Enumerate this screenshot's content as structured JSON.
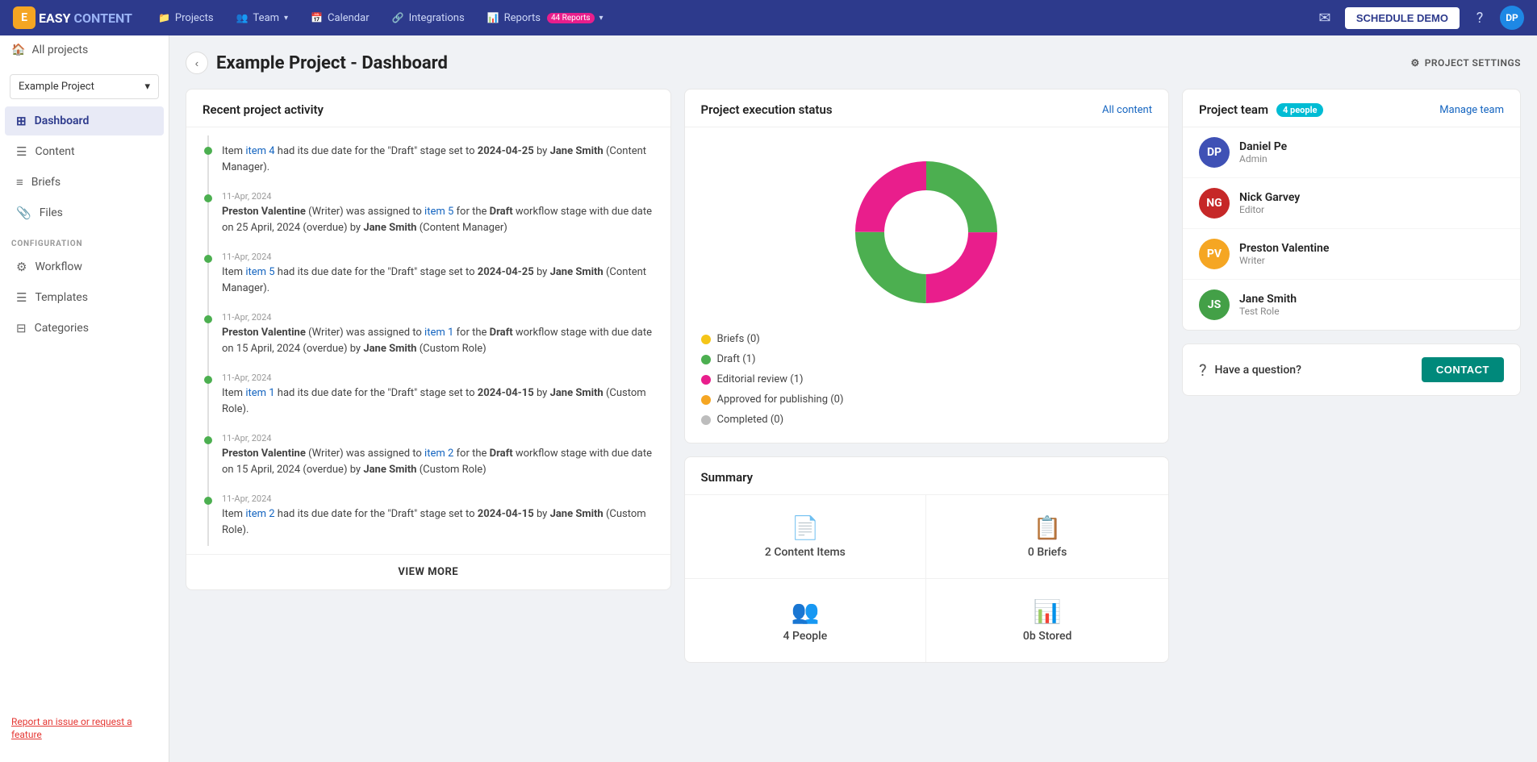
{
  "app": {
    "logo_easy": "EASY",
    "logo_content": "CONTENT",
    "logo_initial": "E"
  },
  "topnav": {
    "projects": "Projects",
    "team": "Team",
    "calendar": "Calendar",
    "integrations": "Integrations",
    "reports": "Reports",
    "reports_badge": "44 Reports",
    "schedule_demo": "SCHEDULE DEMO",
    "user_initials": "DP"
  },
  "sidebar": {
    "all_projects": "All projects",
    "project_name": "Example Project",
    "nav": [
      {
        "id": "dashboard",
        "label": "Dashboard",
        "icon": "⊞",
        "active": true
      },
      {
        "id": "content",
        "label": "Content",
        "icon": "☰",
        "active": false
      },
      {
        "id": "briefs",
        "label": "Briefs",
        "icon": "≡",
        "active": false
      },
      {
        "id": "files",
        "label": "Files",
        "icon": "📎",
        "active": false
      }
    ],
    "config_label": "CONFIGURATION",
    "config_nav": [
      {
        "id": "workflow",
        "label": "Workflow",
        "icon": "⚙"
      },
      {
        "id": "templates",
        "label": "Templates",
        "icon": "☰"
      },
      {
        "id": "categories",
        "label": "Categories",
        "icon": "⊟"
      }
    ],
    "report_issue": "Report an issue or request a feature"
  },
  "page": {
    "title": "Example Project - Dashboard",
    "settings_label": "PROJECT SETTINGS"
  },
  "activity": {
    "header": "Recent project activity",
    "items": [
      {
        "date": "",
        "text_parts": [
          {
            "type": "text",
            "value": "Item "
          },
          {
            "type": "link",
            "value": "item 4"
          },
          {
            "type": "text",
            "value": " had its due date for the \"Draft\" stage set to "
          },
          {
            "type": "bold",
            "value": "2024-04-25"
          },
          {
            "type": "text",
            "value": " by "
          },
          {
            "type": "bold",
            "value": "Jane Smith"
          },
          {
            "type": "text",
            "value": " (Content Manager)."
          }
        ]
      },
      {
        "date": "11-Apr, 2024",
        "html": "<span class='activity-bold'>Preston Valentine</span> (Writer) was assigned to <span class='activity-link'>item 5</span> for the <span class='activity-bold'>Draft</span> workflow stage with due date on 25 April, 2024 (overdue) by <span class='activity-bold'>Jane Smith</span> (Content Manager)"
      },
      {
        "date": "11-Apr, 2024",
        "html": "Item <span class='activity-link'>item 5</span> had its due date for the \"Draft\" stage set to <span class='activity-bold'>2024-04-25</span> by <span class='activity-bold'>Jane Smith</span> (Content Manager)."
      },
      {
        "date": "11-Apr, 2024",
        "html": "<span class='activity-bold'>Preston Valentine</span> (Writer) was assigned to <span class='activity-link'>item 1</span> for the <span class='activity-bold'>Draft</span> workflow stage with due date on 15 April, 2024 (overdue) by <span class='activity-bold'>Jane Smith</span> (Custom Role)"
      },
      {
        "date": "11-Apr, 2024",
        "html": "Item <span class='activity-link'>item 1</span> had its due date for the \"Draft\" stage set to <span class='activity-bold'>2024-04-15</span> by <span class='activity-bold'>Jane Smith</span> (Custom Role)."
      },
      {
        "date": "11-Apr, 2024",
        "html": "<span class='activity-bold'>Preston Valentine</span> (Writer) was assigned to <span class='activity-link'>item 2</span> for the <span class='activity-bold'>Draft</span> workflow stage with due date on 15 April, 2024 (overdue) by <span class='activity-bold'>Jane Smith</span> (Custom Role)"
      },
      {
        "date": "11-Apr, 2024",
        "html": "Item <span class='activity-link'>item 2</span> had its due date for the \"Draft\" stage set to <span class='activity-bold'>2024-04-15</span> by <span class='activity-bold'>Jane Smith</span> (Custom Role)."
      }
    ],
    "view_more": "VIEW MORE"
  },
  "execution": {
    "header": "Project execution status",
    "all_content": "All content",
    "legend": [
      {
        "label": "Briefs (0)",
        "color": "#f5c518"
      },
      {
        "label": "Draft (1)",
        "color": "#4caf50"
      },
      {
        "label": "Editorial review (1)",
        "color": "#e91e8c"
      },
      {
        "label": "Approved for publishing (0)",
        "color": "#f5a623"
      },
      {
        "label": "Completed (0)",
        "color": "#bdbdbd"
      }
    ],
    "donut": {
      "segments": [
        {
          "value": 50,
          "color": "#4caf50"
        },
        {
          "value": 50,
          "color": "#e91e8c"
        }
      ]
    }
  },
  "summary": {
    "header": "Summary",
    "cells": [
      {
        "icon": "📄",
        "icon_color": "#f44336",
        "label": "2 Content Items"
      },
      {
        "icon": "📋",
        "icon_color": "#4caf50",
        "label": "0 Briefs"
      },
      {
        "icon": "👥",
        "icon_color": "#1565c0",
        "label": "4 People"
      },
      {
        "icon": "📊",
        "icon_color": "#e91e8c",
        "label": "0b Stored"
      }
    ]
  },
  "team": {
    "header": "Project team",
    "people_badge": "4 people",
    "manage_link": "Manage team",
    "members": [
      {
        "initials": "DP",
        "name": "Daniel Pe",
        "role": "Admin",
        "color": "#3f51b5"
      },
      {
        "initials": "NG",
        "name": "Nick Garvey",
        "role": "Editor",
        "color": "#c62828"
      },
      {
        "initials": "PV",
        "name": "Preston Valentine",
        "role": "Writer",
        "color": "#f5a623"
      },
      {
        "initials": "JS",
        "name": "Jane Smith",
        "role": "Test Role",
        "color": "#43a047"
      }
    ]
  },
  "contact": {
    "label": "Have a question?",
    "button": "CONTACT"
  }
}
